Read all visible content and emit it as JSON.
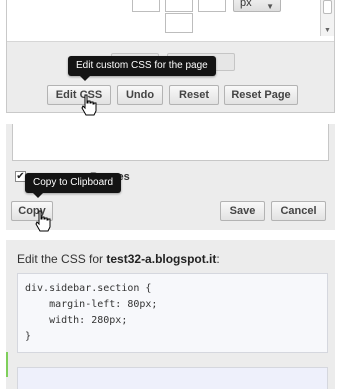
{
  "panel1": {
    "unit_select": "px",
    "tooltip": "Edit custom CSS for the page",
    "buttons": {
      "edit_css": "Edit CSS",
      "undo": "Undo",
      "reset": "Reset",
      "reset_page": "Reset Page"
    }
  },
  "panel2": {
    "checkbox_label": "Ranges",
    "tooltip": "Copy to Clipboard",
    "buttons": {
      "copy": "Copy",
      "save": "Save",
      "cancel": "Cancel"
    }
  },
  "panel3": {
    "heading_prefix": "Edit the CSS for ",
    "heading_site": "test32-a.blogspot.it",
    "heading_suffix": ":",
    "code_lines": [
      "div.sidebar.section {",
      "    margin-left: 80px;",
      "    width: 280px;",
      "}"
    ]
  },
  "colors": {
    "tooltip_bg": "#141414",
    "panel_bg": "#ececec",
    "accent_green": "#7fcf5b"
  }
}
